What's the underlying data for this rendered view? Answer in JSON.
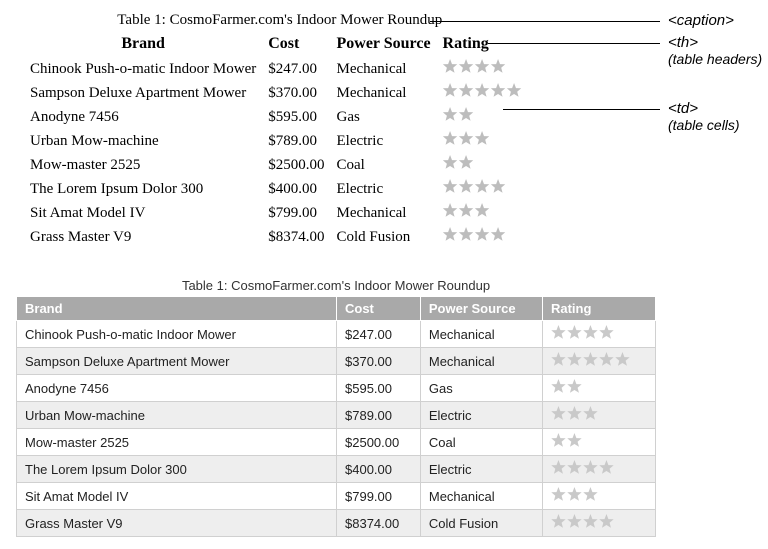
{
  "table": {
    "caption": "Table 1: CosmoFarmer.com's Indoor Mower Roundup",
    "headers": [
      "Brand",
      "Cost",
      "Power Source",
      "Rating"
    ],
    "rows": [
      {
        "brand": "Chinook Push-o-matic Indoor Mower",
        "cost": "$247.00",
        "power": "Mechanical",
        "rating": 4
      },
      {
        "brand": "Sampson Deluxe Apartment Mower",
        "cost": "$370.00",
        "power": "Mechanical",
        "rating": 5
      },
      {
        "brand": "Anodyne 7456",
        "cost": "$595.00",
        "power": "Gas",
        "rating": 2
      },
      {
        "brand": "Urban Mow-machine",
        "cost": "$789.00",
        "power": "Electric",
        "rating": 3
      },
      {
        "brand": "Mow-master 2525",
        "cost": "$2500.00",
        "power": "Coal",
        "rating": 2
      },
      {
        "brand": "The Lorem Ipsum Dolor 300",
        "cost": "$400.00",
        "power": "Electric",
        "rating": 4
      },
      {
        "brand": "Sit Amat Model IV",
        "cost": "$799.00",
        "power": "Mechanical",
        "rating": 3
      },
      {
        "brand": "Grass Master V9",
        "cost": "$8374.00",
        "power": "Cold Fusion",
        "rating": 4
      }
    ]
  },
  "annotations": {
    "caption": "<caption>",
    "th": "<th>",
    "th_sub": "(table headers)",
    "td": "<td>",
    "td_sub": "(table cells)"
  }
}
